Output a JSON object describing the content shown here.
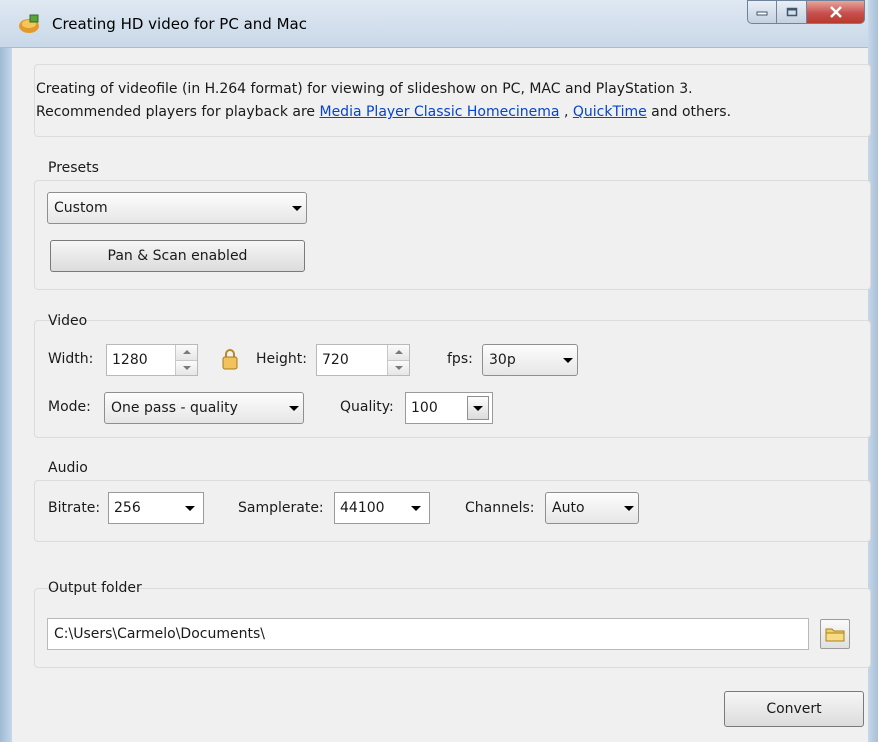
{
  "window": {
    "title": "Creating HD video for PC and Mac",
    "app_icon": "app-icon",
    "controls": [
      "minimize-icon",
      "maximize-icon",
      "close-icon"
    ]
  },
  "info": {
    "line1": "Creating of videofile (in H.264 format) for viewing of slideshow on PC, MAC and PlayStation 3.",
    "line2_prefix": "Recommended players for playback are ",
    "link1": "Media Player Classic Homecinema",
    "separator": " , ",
    "link2": "QuickTime",
    "line2_suffix": " and others."
  },
  "presets": {
    "legend": "Presets",
    "selected": "Custom",
    "pan_scan_button": "Pan & Scan enabled"
  },
  "video": {
    "legend": "Video",
    "width_label": "Width:",
    "width_value": "1280",
    "height_label": "Height:",
    "height_value": "720",
    "fps_label": "fps:",
    "fps_value": "30p",
    "mode_label": "Mode:",
    "mode_value": "One pass - quality",
    "quality_label": "Quality:",
    "quality_value": "100",
    "lock_icon": "lock-icon"
  },
  "audio": {
    "legend": "Audio",
    "bitrate_label": "Bitrate:",
    "bitrate_value": "256",
    "samplerate_label": "Samplerate:",
    "samplerate_value": "44100",
    "channels_label": "Channels:",
    "channels_value": "Auto"
  },
  "output": {
    "legend": "Output folder",
    "path": "C:\\Users\\Carmelo\\Documents\\",
    "browse_icon": "folder-icon"
  },
  "actions": {
    "convert": "Convert"
  },
  "colors": {
    "link": "#0645c8",
    "close_button": "#c75050",
    "dialog_bg": "#f0f0f0",
    "titlebar": "#c9d8e8"
  }
}
